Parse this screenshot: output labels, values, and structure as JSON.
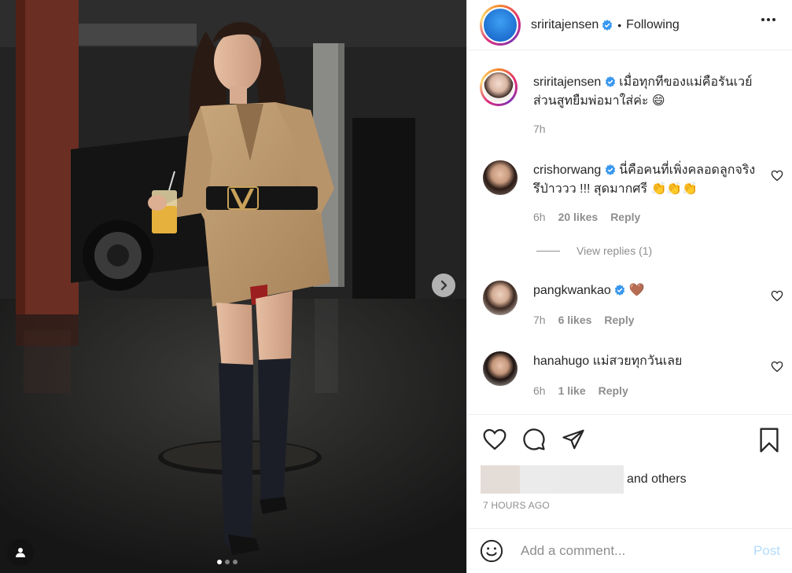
{
  "post": {
    "username": "sriritajensen",
    "separator": "•",
    "follow_status": "Following",
    "image_count": 3,
    "active_image": 1
  },
  "caption": {
    "username": "sriritajensen",
    "text": "เมื่อทุกทีของแม่คือรันเวย์ ส่วนสูทยืมพ่อมาใส่ค่ะ 😄",
    "time": "7h"
  },
  "comments": [
    {
      "username": "crishorwang",
      "verified": true,
      "text": "นี่คือคนที่เพิ่งคลอดลูกจริงรึป่าววว !!! สุดมากศรี 👏👏👏",
      "time": "6h",
      "likes": "20 likes",
      "reply": "Reply"
    },
    {
      "username": "pangkwankao",
      "verified": true,
      "text": "🤎",
      "time": "7h",
      "likes": "6 likes",
      "reply": "Reply"
    },
    {
      "username": "hanahugo",
      "verified": false,
      "text": "แม่สวยทุกวันเลย",
      "time": "6h",
      "likes": "1 like",
      "reply": "Reply"
    }
  ],
  "view_replies": "View replies (1)",
  "likes": {
    "suffix_and": "and",
    "suffix_others": "others"
  },
  "timestamp": "7 HOURS AGO",
  "add_comment": {
    "placeholder": "Add a comment...",
    "post_label": "Post"
  },
  "colors": {
    "verified": "#3897f0",
    "post_disabled": "#b3dbff",
    "muted": "#8e8e8e"
  },
  "icons": [
    "more-options-icon",
    "verified-icon",
    "heart-icon",
    "comment-icon",
    "share-icon",
    "bookmark-icon",
    "emoji-icon",
    "chevron-right-icon",
    "user-tag-icon"
  ]
}
